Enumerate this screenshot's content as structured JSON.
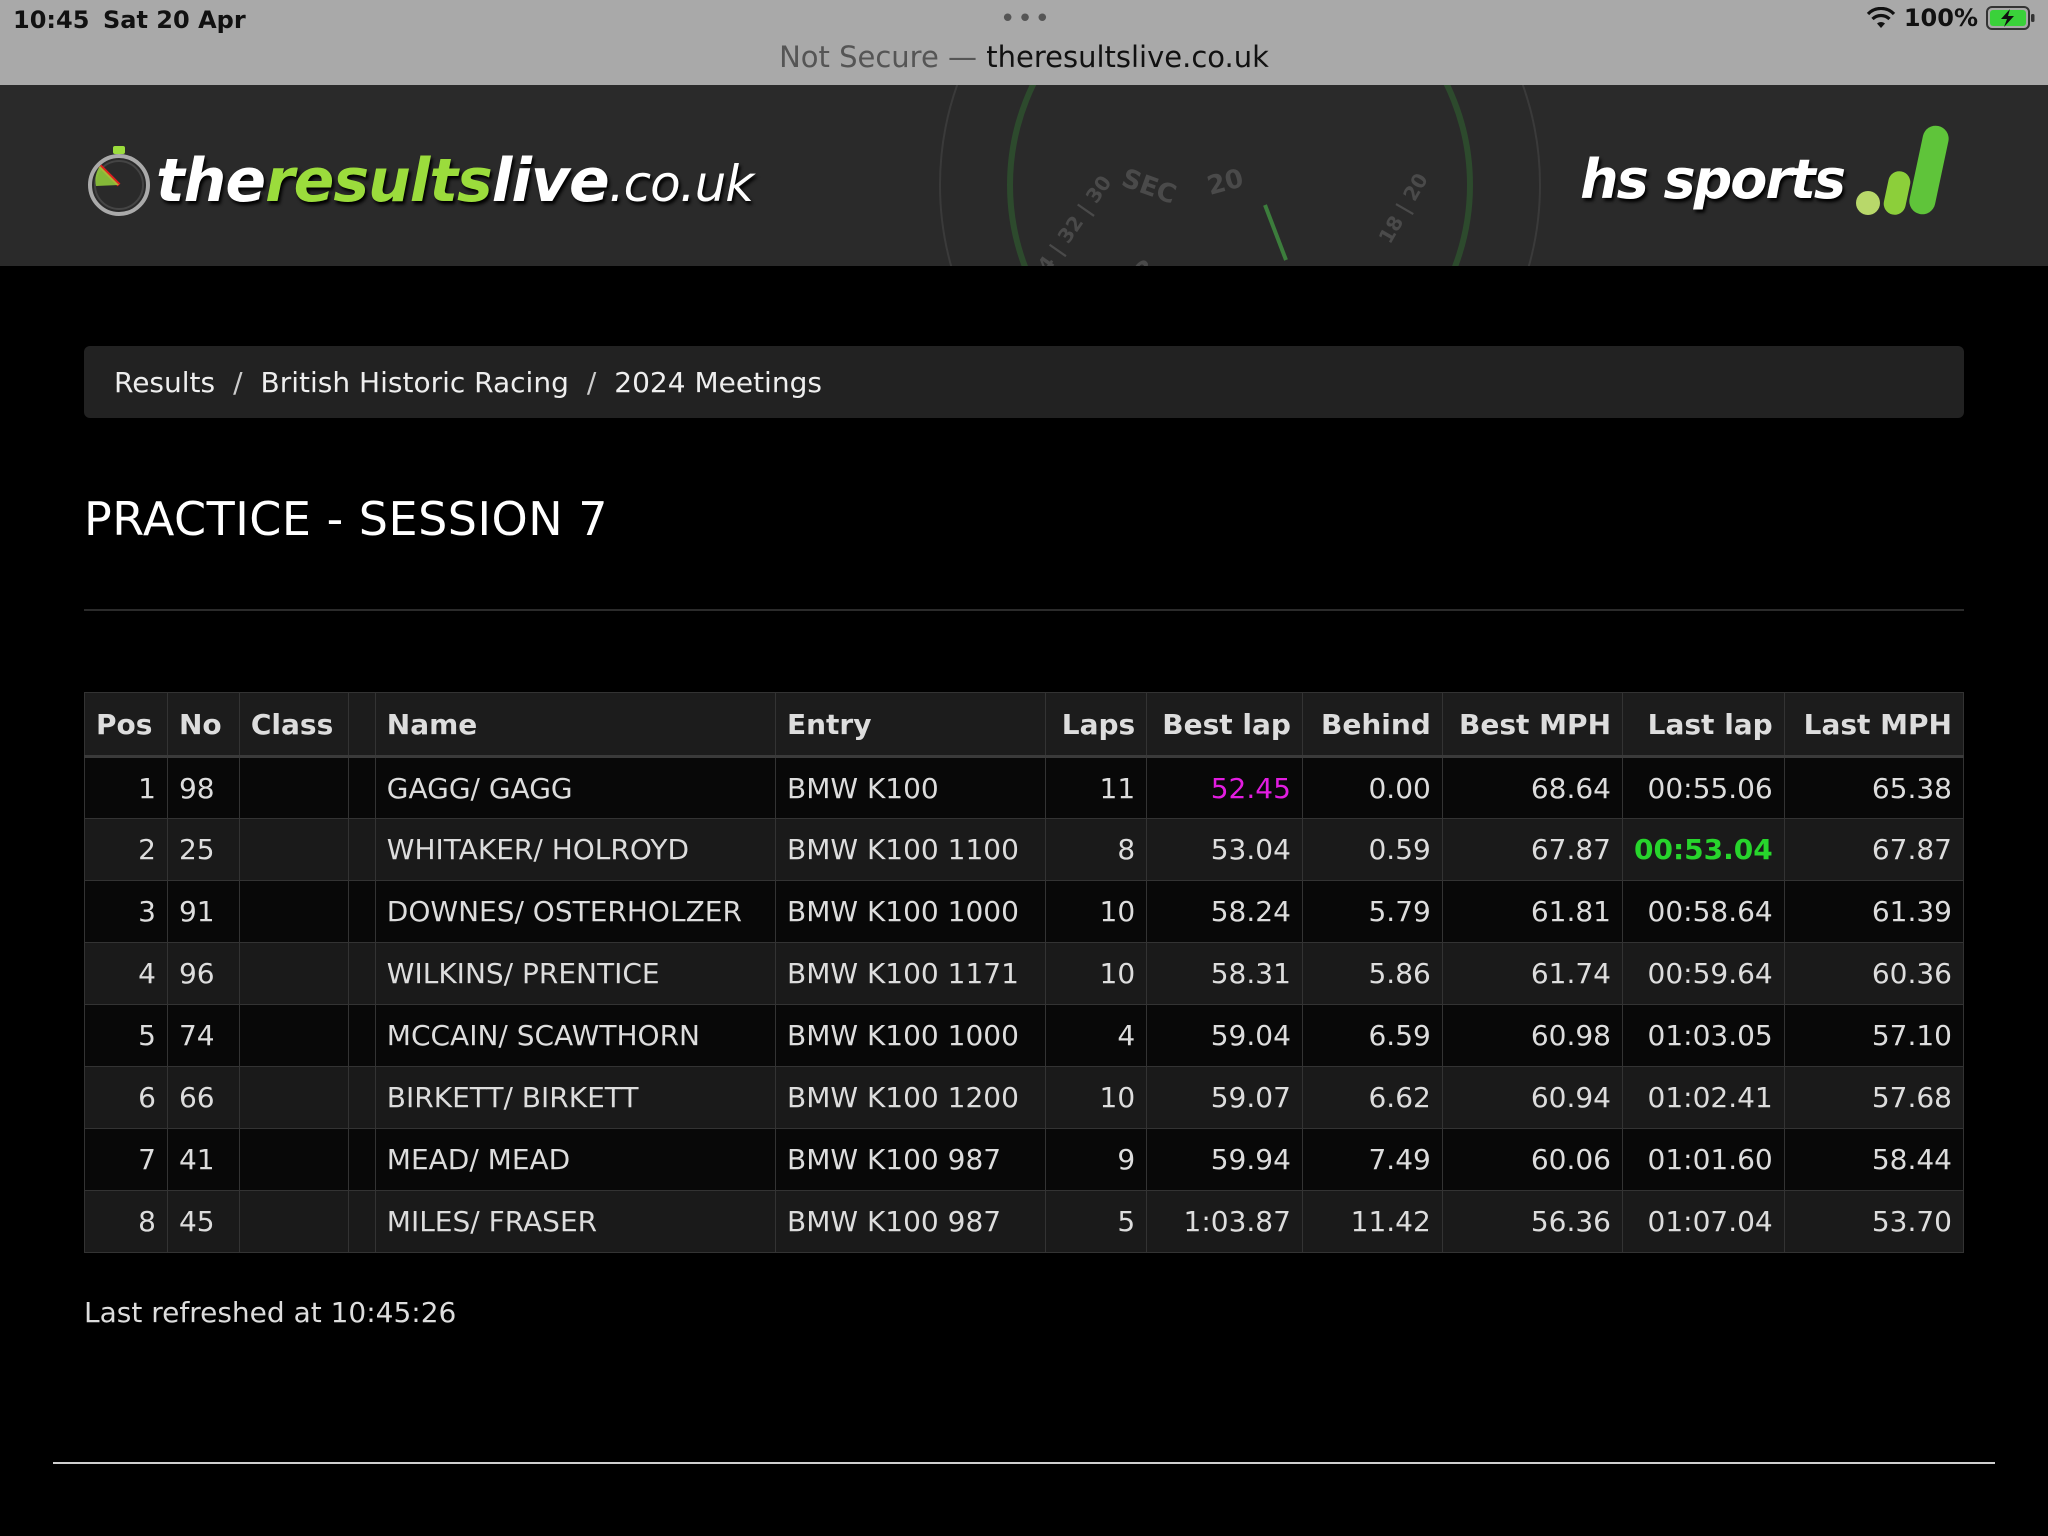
{
  "statusbar": {
    "time": "10:45",
    "date": "Sat 20 Apr",
    "battery": "100%",
    "url_prefix": "Not Secure —",
    "url_host": "theresultslive.co.uk"
  },
  "banner": {
    "logo_the": "the",
    "logo_results": "results",
    "logo_live": "live",
    "logo_couk": ".co.uk",
    "partner": "hs sports"
  },
  "breadcrumb": {
    "items": [
      "Results",
      "British Historic Racing",
      "2024 Meetings"
    ],
    "separator": "/"
  },
  "page": {
    "title": "PRACTICE - SESSION 7",
    "refreshed": "Last refreshed at 10:45:26"
  },
  "table": {
    "headers": [
      "Pos",
      "No",
      "Class",
      "",
      "Name",
      "Entry",
      "Laps",
      "Best lap",
      "Behind",
      "Best MPH",
      "Last lap",
      "Last MPH"
    ],
    "rows": [
      {
        "pos": "1",
        "no": "98",
        "class": "",
        "name": "GAGG/ GAGG",
        "entry": "BMW K100",
        "laps": "11",
        "best_lap": "52.45",
        "behind": "0.00",
        "best_mph": "68.64",
        "last_lap": "00:55.06",
        "last_mph": "65.38"
      },
      {
        "pos": "2",
        "no": "25",
        "class": "",
        "name": "WHITAKER/ HOLROYD",
        "entry": "BMW K100 1100",
        "laps": "8",
        "best_lap": "53.04",
        "behind": "0.59",
        "best_mph": "67.87",
        "last_lap": "00:53.04",
        "last_mph": "67.87"
      },
      {
        "pos": "3",
        "no": "91",
        "class": "",
        "name": "DOWNES/ OSTERHOLZER",
        "entry": "BMW K100 1000",
        "laps": "10",
        "best_lap": "58.24",
        "behind": "5.79",
        "best_mph": "61.81",
        "last_lap": "00:58.64",
        "last_mph": "61.39"
      },
      {
        "pos": "4",
        "no": "96",
        "class": "",
        "name": "WILKINS/ PRENTICE",
        "entry": "BMW K100 1171",
        "laps": "10",
        "best_lap": "58.31",
        "behind": "5.86",
        "best_mph": "61.74",
        "last_lap": "00:59.64",
        "last_mph": "60.36"
      },
      {
        "pos": "5",
        "no": "74",
        "class": "",
        "name": "MCCAIN/ SCAWTHORN",
        "entry": "BMW K100 1000",
        "laps": "4",
        "best_lap": "59.04",
        "behind": "6.59",
        "best_mph": "60.98",
        "last_lap": "01:03.05",
        "last_mph": "57.10"
      },
      {
        "pos": "6",
        "no": "66",
        "class": "",
        "name": "BIRKETT/ BIRKETT",
        "entry": "BMW K100 1200",
        "laps": "10",
        "best_lap": "59.07",
        "behind": "6.62",
        "best_mph": "60.94",
        "last_lap": "01:02.41",
        "last_mph": "57.68"
      },
      {
        "pos": "7",
        "no": "41",
        "class": "",
        "name": "MEAD/ MEAD",
        "entry": "BMW K100 987",
        "laps": "9",
        "best_lap": "59.94",
        "behind": "7.49",
        "best_mph": "60.06",
        "last_lap": "01:01.60",
        "last_mph": "58.44"
      },
      {
        "pos": "8",
        "no": "45",
        "class": "",
        "name": "MILES/ FRASER",
        "entry": "BMW K100 987",
        "laps": "5",
        "best_lap": "1:03.87",
        "behind": "11.42",
        "best_mph": "56.36",
        "last_lap": "01:07.04",
        "last_mph": "53.70"
      }
    ]
  },
  "colors": {
    "fastest_lap": "#e21de0",
    "personal_best": "#27d52c",
    "logo_green": "#9bdc3c"
  }
}
